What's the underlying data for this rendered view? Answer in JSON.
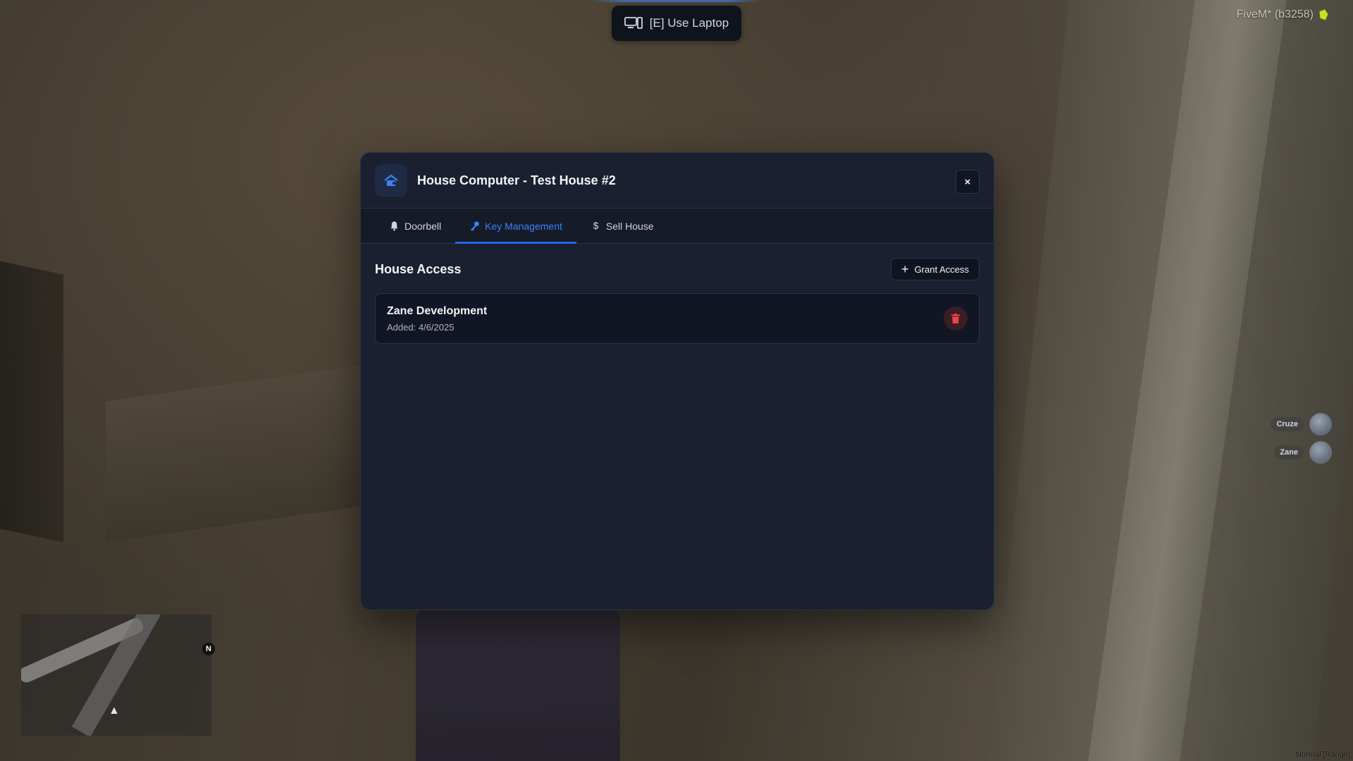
{
  "prompt": {
    "label": "[E] Use Laptop",
    "icon": "laptop-icon"
  },
  "server": {
    "label": "FiveM* (b3258)"
  },
  "voice": {
    "players": [
      {
        "name": "Cruze"
      },
      {
        "name": "Zane"
      }
    ],
    "mode": "Normal [Range]"
  },
  "minimap": {
    "north": "N"
  },
  "modal": {
    "title": "House Computer - Test House #2",
    "close_label": "×",
    "tabs": [
      {
        "label": "Doorbell",
        "icon": "bell-icon"
      },
      {
        "label": "Key Management",
        "icon": "key-icon",
        "active": true
      },
      {
        "label": "Sell House",
        "icon": "dollar-icon"
      }
    ],
    "section_title": "House Access",
    "grant_button": "Grant Access",
    "access_list": [
      {
        "name": "Zane Development",
        "added": "Added: 4/6/2025"
      }
    ]
  },
  "colors": {
    "accent": "#2563eb",
    "modal_bg": "#1a2030",
    "danger": "#ef4444"
  }
}
